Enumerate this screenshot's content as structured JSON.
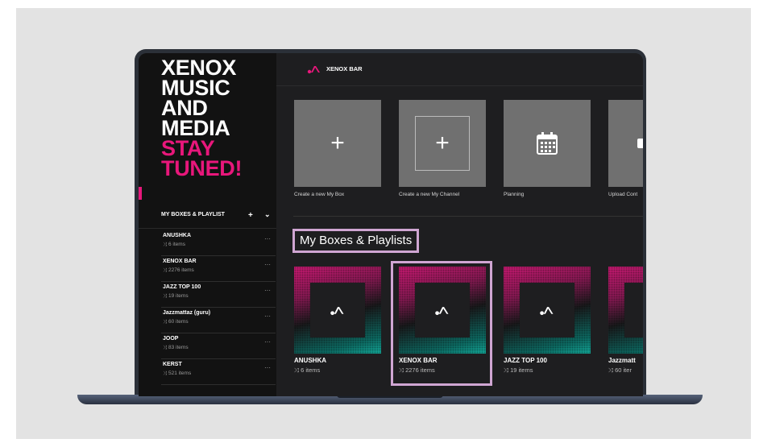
{
  "hero": {
    "lines_white": [
      "XENOX",
      "MUSIC",
      "AND",
      "MEDIA"
    ],
    "lines_pink": [
      "STAY",
      "TUNED!"
    ]
  },
  "sidebar": {
    "header": "MY BOXES & PLAYLIST",
    "add_symbol": "+",
    "chevron_symbol": "⌄",
    "items": [
      {
        "title": "ANUSHKA",
        "count": "6 items"
      },
      {
        "title": "XENOX BAR",
        "count": "2276 items"
      },
      {
        "title": "JAZZ TOP 100",
        "count": "19 items"
      },
      {
        "title": "Jazzmattaz (guru)",
        "count": "60 items"
      },
      {
        "title": "JOOP",
        "count": "83 items"
      },
      {
        "title": "KERST",
        "count": "521 items"
      }
    ]
  },
  "topbar": {
    "brand": "XENOX BAR"
  },
  "actions": [
    {
      "label": "Create a new My Box",
      "icon": "plus-icon"
    },
    {
      "label": "Create a new My Channel",
      "icon": "plus-box-icon"
    },
    {
      "label": "Planning",
      "icon": "calendar-icon"
    },
    {
      "label": "Upload Cont",
      "icon": "upload-icon"
    }
  ],
  "section": {
    "title": "My Boxes & Playlists"
  },
  "playlists": [
    {
      "title": "ANUSHKA",
      "count": "6 items"
    },
    {
      "title": "XENOX BAR",
      "count": "2276 items"
    },
    {
      "title": "JAZZ TOP 100",
      "count": "19 items"
    },
    {
      "title": "Jazzmatt",
      "count": "60 iter"
    }
  ],
  "colors": {
    "accent": "#e8177b",
    "highlight": "#d0a6d3",
    "tile": "#707070",
    "background": "#1e1e20"
  }
}
